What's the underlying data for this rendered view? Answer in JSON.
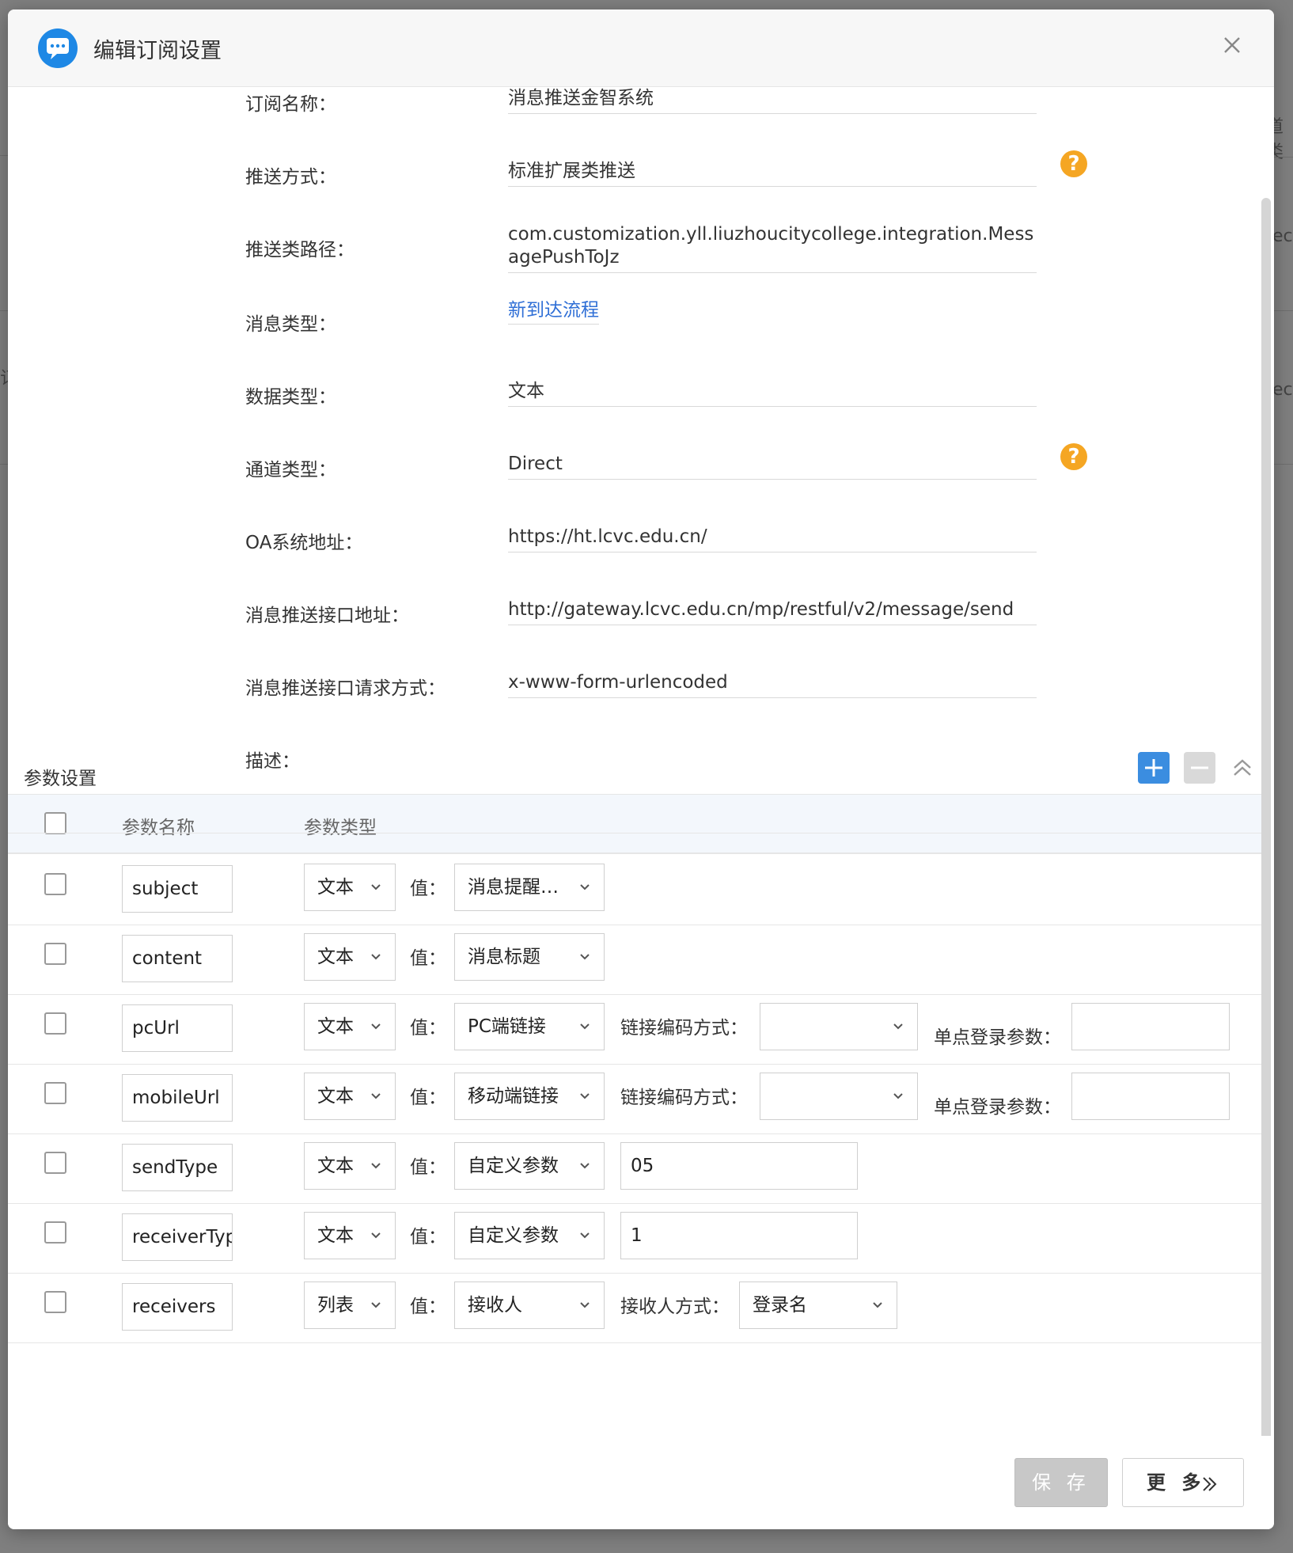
{
  "dialog": {
    "title": "编辑订阅设置",
    "accent_color": "#1e88e5",
    "logo_icon": "chat-bubble-icon",
    "close_icon": "close-icon"
  },
  "background": {
    "frag_1": "道类",
    "frag_2": "ect",
    "frag_3": "ect",
    "frag_4": "订"
  },
  "form": {
    "fields": [
      {
        "label": "订阅名称：",
        "value": "消息推送金智系统"
      },
      {
        "label": "推送方式：",
        "value": "标准扩展类推送",
        "help": "?"
      },
      {
        "label": "推送类路径：",
        "value": "com.customization.yll.liuzhoucitycollege.integration.MessagePushToJz"
      },
      {
        "label": "消息类型：",
        "value": "新到达流程"
      },
      {
        "label": "数据类型：",
        "value": "文本"
      },
      {
        "label": "通道类型：",
        "value": "Direct",
        "help": "?"
      },
      {
        "label": "OA系统地址：",
        "value": "https://ht.lcvc.edu.cn/"
      },
      {
        "label": "消息推送接口地址：",
        "value": "http://gateway.lcvc.edu.cn/mp/restful/v2/message/send"
      },
      {
        "label": "消息推送接口请求方式：",
        "value": "x-www-form-urlencoded"
      },
      {
        "label": "描述：",
        "value": ""
      }
    ],
    "link_color": "#2f6fd6",
    "help_color": "#f5a623"
  },
  "params": {
    "section_title": "参数设置",
    "add_icon": "plus-icon",
    "remove_icon": "minus-icon",
    "collapse_icon": "double-chevron-up-icon",
    "headers": {
      "name": "参数名称",
      "type": "参数类型"
    },
    "value_label": "值：",
    "encode_label": "链接编码方式：",
    "sso_label": "单点登录参数：",
    "receiver_mode_label": "接收人方式：",
    "rows": [
      {
        "name": "subject",
        "type": "文本",
        "value": "消息提醒…"
      },
      {
        "name": "content",
        "type": "文本",
        "value": "消息标题"
      },
      {
        "name": "pcUrl",
        "type": "文本",
        "value": "PC端链接",
        "encode": "",
        "sso": ""
      },
      {
        "name": "mobileUrl",
        "type": "文本",
        "value": "移动端链接",
        "encode": "",
        "sso": ""
      },
      {
        "name": "sendType",
        "type": "文本",
        "value": "自定义参数",
        "custom": "05"
      },
      {
        "name": "receiverTyp",
        "type": "文本",
        "value": "自定义参数",
        "custom": "1"
      },
      {
        "name": "receivers",
        "type": "列表",
        "value": "接收人",
        "receiver_mode": "登录名"
      }
    ]
  },
  "footer": {
    "save_label": "保 存",
    "more_label": "更 多"
  }
}
